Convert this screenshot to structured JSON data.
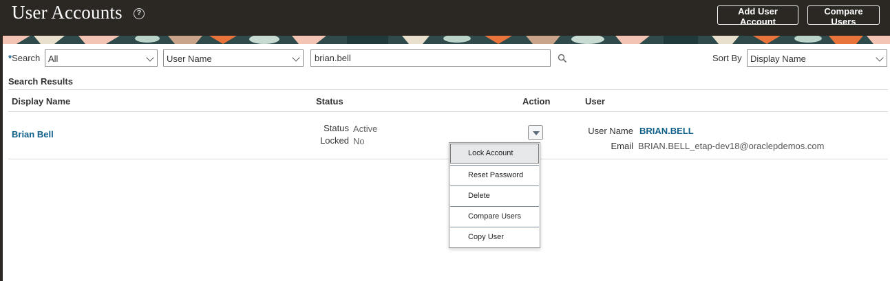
{
  "header": {
    "title": "User Accounts",
    "help_icon": "question-circle-icon",
    "add_user_button": "Add User Account",
    "compare_users_button": "Compare Users"
  },
  "search": {
    "label_required_mark": "*",
    "label": "Search",
    "scope_value": "All",
    "field_value": "User Name",
    "query_value": "brian.bell",
    "search_icon": "magnifier-icon",
    "sort_label": "Sort By",
    "sort_value": "Display Name"
  },
  "results": {
    "title": "Search Results",
    "columns": [
      "Display Name",
      "Status",
      "Action",
      "User"
    ],
    "rows": [
      {
        "display_name": "Brian Bell",
        "status_label": "Status",
        "status_value": "Active",
        "locked_label": "Locked",
        "locked_value": "No",
        "user_name_label": "User Name",
        "user_name_value": "BRIAN.BELL",
        "email_label": "Email",
        "email_value": "BRIAN.BELL_etap-dev18@oraclepdemos.com"
      }
    ]
  },
  "action_menu": {
    "items": [
      "Lock Account",
      "Reset Password",
      "Delete",
      "Compare Users",
      "Copy User"
    ],
    "highlighted": "Lock Account"
  },
  "colors": {
    "header_bg": "#2b2824",
    "link": "#0e5f8a",
    "banner_teal": "#2e4a4a",
    "banner_orange": "#e8743b",
    "banner_pink": "#f3c4b4"
  }
}
